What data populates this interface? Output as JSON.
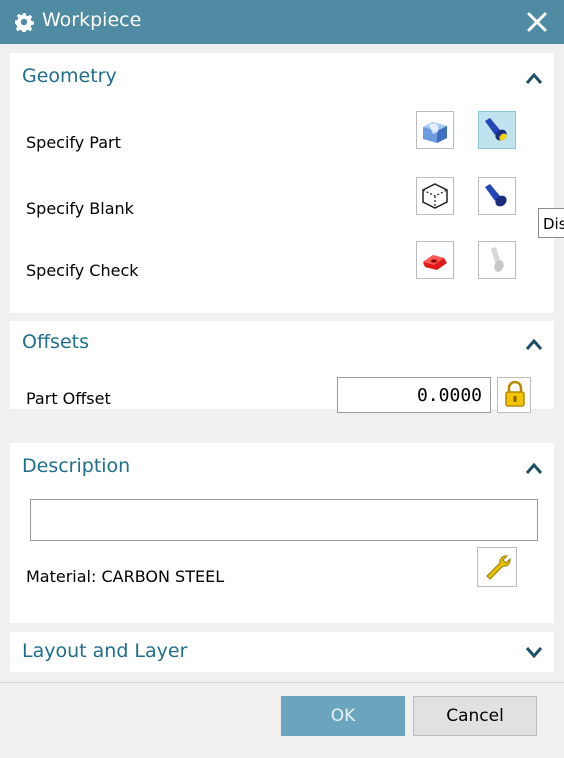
{
  "window": {
    "title": "Workpiece",
    "icon": "gear-icon",
    "close_icon": "close-icon"
  },
  "colors": {
    "titlebar": "#4f8ba2",
    "section_title": "#1f6f8b",
    "ok_button": "#6aa5bd",
    "selected_tool": "#bfe3ef"
  },
  "geometry": {
    "title": "Geometry",
    "rows": [
      {
        "label": "Specify Part"
      },
      {
        "label": "Specify Blank"
      },
      {
        "label": "Specify Check"
      }
    ],
    "tooltip": "Disp"
  },
  "offsets": {
    "title": "Offsets",
    "part_offset_label": "Part Offset",
    "part_offset_value": "0.0000"
  },
  "description": {
    "title": "Description",
    "text_value": "",
    "material_label": "Material: CARBON STEEL"
  },
  "layout": {
    "title": "Layout and Layer"
  },
  "buttons": {
    "ok": "OK",
    "cancel": "Cancel"
  }
}
